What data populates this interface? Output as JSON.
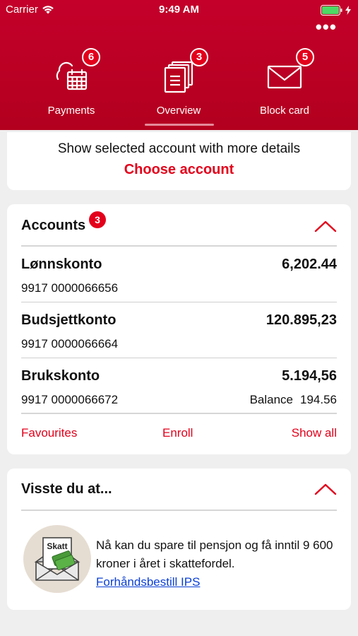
{
  "status_bar": {
    "carrier": "Carrier",
    "time": "9:49 AM"
  },
  "tabs": [
    {
      "label": "Payments",
      "badge": "6",
      "icon": "calendar-payments-icon"
    },
    {
      "label": "Overview",
      "badge": "3",
      "icon": "documents-icon"
    },
    {
      "label": "Block card",
      "badge": "5",
      "icon": "envelope-icon"
    }
  ],
  "select_account": {
    "description": "Show selected account with more details",
    "link": "Choose account"
  },
  "accounts": {
    "title": "Accounts",
    "badge": "3",
    "items": [
      {
        "name": "Lønnskonto",
        "amount": "6,202.44",
        "number": "9917 0000066656"
      },
      {
        "name": "Budsjettkonto",
        "amount": "120.895,23",
        "number": "9917 0000066664"
      },
      {
        "name": "Brukskonto",
        "amount": "5.194,56",
        "number": "9917 0000066672",
        "balance_label": "Balance",
        "balance_value": "194.56"
      }
    ],
    "actions": {
      "favourites": "Favourites",
      "enroll": "Enroll",
      "show_all": "Show all"
    }
  },
  "tip_card": {
    "title": "Visste du at...",
    "envelope_label": "Skatt",
    "text": "Nå kan du spare til pensjon og få inntil 9 600 kroner i året i skattefordel.",
    "link": "Forhåndsbestill IPS"
  },
  "colors": {
    "brand_red": "#c4002a",
    "accent_red": "#e3001b",
    "link_blue": "#0b3fd6"
  }
}
